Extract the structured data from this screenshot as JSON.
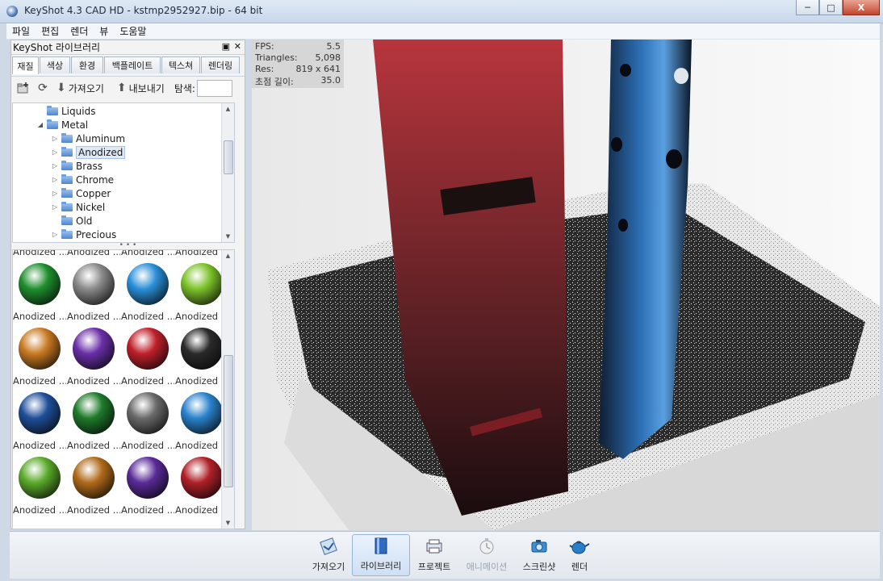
{
  "window": {
    "title": "KeyShot 4.3 CAD HD  -  kstmp2952927.bip  - 64 bit",
    "controls": [
      "─",
      "□",
      "X"
    ]
  },
  "menu": [
    "파일",
    "편집",
    "렌더",
    "뷰",
    "도움말"
  ],
  "library": {
    "header": "KeyShot 라이브러리",
    "tabs": [
      "재질",
      "색상",
      "환경",
      "백플레이트",
      "텍스쳐",
      "렌더링"
    ],
    "active_tab": "재질",
    "toolbar": {
      "import_label": "가져오기",
      "export_label": "내보내기",
      "search_label": "탐색:",
      "search_value": ""
    },
    "tree": [
      {
        "label": "Liquids",
        "level": 1,
        "expander": ""
      },
      {
        "label": "Metal",
        "level": 1,
        "expander": "◢"
      },
      {
        "label": "Aluminum",
        "level": 2,
        "expander": "▷"
      },
      {
        "label": "Anodized",
        "level": 2,
        "expander": "▷",
        "selected": true
      },
      {
        "label": "Brass",
        "level": 2,
        "expander": "▷"
      },
      {
        "label": "Chrome",
        "level": 2,
        "expander": "▷"
      },
      {
        "label": "Copper",
        "level": 2,
        "expander": "▷"
      },
      {
        "label": "Nickel",
        "level": 2,
        "expander": "▷"
      },
      {
        "label": "Old",
        "level": 2,
        "expander": ""
      },
      {
        "label": "Precious",
        "level": 2,
        "expander": "▷"
      }
    ],
    "swatches": [
      {
        "label": "Anodized ...",
        "color": "#1f8f2e"
      },
      {
        "label": "Anodized ...",
        "color": "#8a8a8a"
      },
      {
        "label": "Anodized ...",
        "color": "#2a8fd8"
      },
      {
        "label": "Anodized ...",
        "color": "#7cc22a"
      },
      {
        "label": "Anodized ...",
        "color": "#c97a22"
      },
      {
        "label": "Anodized ...",
        "color": "#6a2fa8"
      },
      {
        "label": "Anodized ...",
        "color": "#c0202a"
      },
      {
        "label": "Anodized ...",
        "color": "#2a2a2a"
      },
      {
        "label": "Anodized ...",
        "color": "#1f4f9a"
      },
      {
        "label": "Anodized ...",
        "color": "#1f7a2a"
      },
      {
        "label": "Anodized ...",
        "color": "#6a6a6a"
      },
      {
        "label": "Anodized ...",
        "color": "#2a82cc"
      },
      {
        "label": "Anodized ...",
        "color": "#5aaa2a"
      },
      {
        "label": "Anodized ...",
        "color": "#b06a1a"
      },
      {
        "label": "Anodized ...",
        "color": "#5a2a98"
      },
      {
        "label": "Anodized ...",
        "color": "#b02028"
      }
    ]
  },
  "stats": [
    {
      "key": "FPS:",
      "value": "5.5"
    },
    {
      "key": "Triangles:",
      "value": "5,098"
    },
    {
      "key": "Res:",
      "value": "819 x 641"
    },
    {
      "key": "초점 길이:",
      "value": "35.0"
    }
  ],
  "bottom_bar": [
    {
      "label": "가져오기",
      "icon": "import-icon"
    },
    {
      "label": "라이브러리",
      "icon": "library-icon",
      "active": true
    },
    {
      "label": "프로젝트",
      "icon": "project-icon"
    },
    {
      "label": "애니메이션",
      "icon": "animation-icon",
      "disabled": true
    },
    {
      "label": "스크린샷",
      "icon": "screenshot-icon"
    },
    {
      "label": "렌더",
      "icon": "render-icon"
    }
  ]
}
